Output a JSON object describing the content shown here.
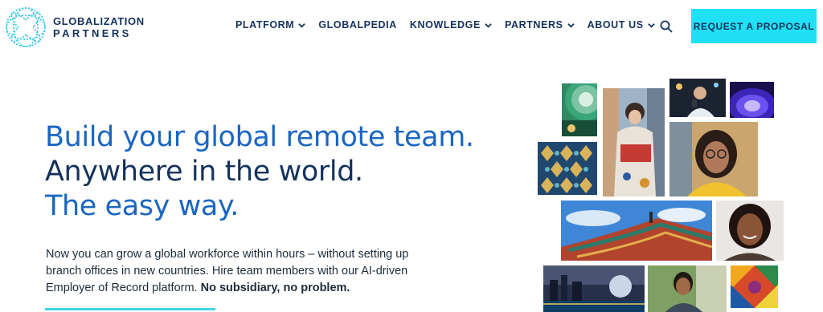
{
  "logo": {
    "line1": "GLOBALIZATION",
    "line2": "PARTNERS"
  },
  "nav": {
    "items": [
      {
        "label": "PLATFORM",
        "dropdown": true
      },
      {
        "label": "GLOBALPEDIA",
        "dropdown": false
      },
      {
        "label": "KNOWLEDGE",
        "dropdown": true
      },
      {
        "label": "PARTNERS",
        "dropdown": true
      },
      {
        "label": "ABOUT US",
        "dropdown": true
      }
    ],
    "search_icon": "search-icon",
    "cta_label": "REQUEST A PROPOSAL"
  },
  "hero": {
    "title_line1": "Build your global remote team.",
    "title_line2": "Anywhere in the world.",
    "title_line3": "The easy way.",
    "copy_main": "Now you can grow a global workforce within hours – without setting up branch offices in new countries. Hire team members with our AI-driven Employer of Record platform. ",
    "copy_bold": "No subsidiary, no problem."
  },
  "colors": {
    "brand_navy": "#14325c",
    "brand_blue": "#1a66c2",
    "cta_cyan": "#1fe0f4",
    "logo_cyan": "#2ec4e6"
  }
}
